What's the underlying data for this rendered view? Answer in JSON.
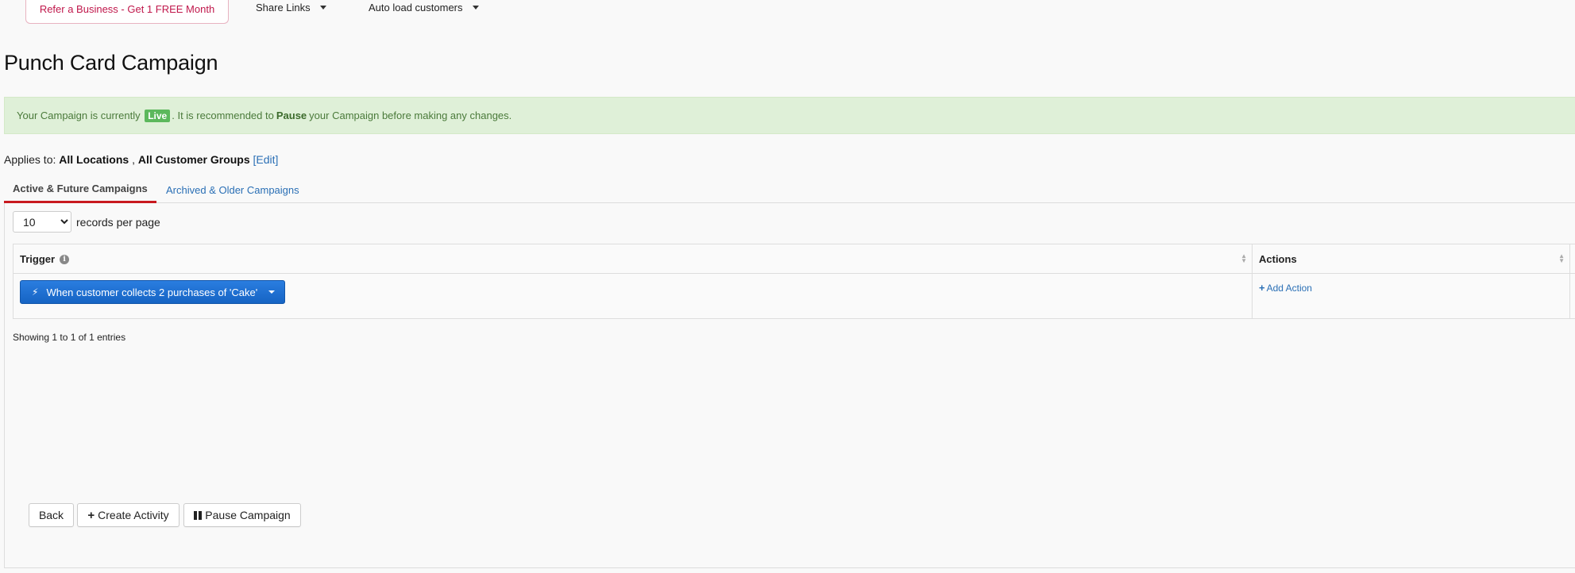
{
  "topbar": {
    "refer_label": "Refer a Business - Get 1 FREE Month",
    "share_links_label": "Share Links",
    "auto_load_label": "Auto load customers"
  },
  "page": {
    "title": "Punch Card Campaign"
  },
  "alert": {
    "prefix": "Your Campaign is currently",
    "status_badge": "Live",
    "middle": ". It is recommended to",
    "pause_word": "Pause",
    "suffix": "your Campaign before making any changes."
  },
  "applies": {
    "label": "Applies to:",
    "locations": "All Locations",
    "separator": ",",
    "groups": "All Customer Groups",
    "edit_label": "[Edit]"
  },
  "tabs": [
    {
      "label": "Active & Future Campaigns",
      "active": true
    },
    {
      "label": "Archived & Older Campaigns",
      "active": false
    }
  ],
  "records": {
    "selected": "10",
    "options": [
      "10"
    ],
    "suffix": "records per page"
  },
  "table": {
    "columns": [
      "Trigger",
      "Actions"
    ],
    "rows": [
      {
        "trigger": "When customer collects 2 purchases of 'Cake'",
        "action_link": "Add Action"
      }
    ],
    "footer": "Showing 1 to 1 of 1 entries"
  },
  "buttons": {
    "back": "Back",
    "create_activity": "Create Activity",
    "pause_campaign": "Pause Campaign"
  },
  "colors": {
    "accent_red": "#c8191e",
    "link_blue": "#2a6fb5",
    "primary_blue": "#1f6fd1",
    "alert_green_bg": "#dff0d8",
    "live_green": "#5cb85c",
    "refer_pink": "#c0174b"
  },
  "icons": {
    "info": "info-icon",
    "bolt": "bolt-icon",
    "plus": "plus-icon",
    "pause": "pause-icon",
    "sort": "sort-icon"
  }
}
